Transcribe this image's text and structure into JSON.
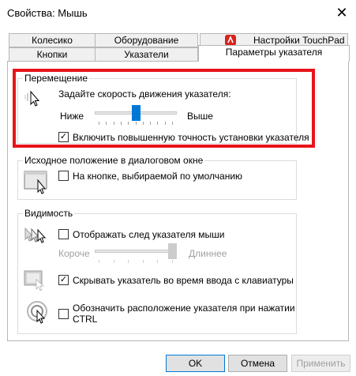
{
  "window": {
    "title": "Свойства: Мышь",
    "close_glyph": "✕"
  },
  "tabs": {
    "row1": [
      "Колесико",
      "Оборудование",
      "Настройки TouchPad"
    ],
    "row2": [
      "Кнопки",
      "Указатели",
      "Параметры указателя"
    ]
  },
  "motion": {
    "title": "Перемещение",
    "speed_label": "Задайте скорость движения указателя:",
    "slow_label": "Ниже",
    "fast_label": "Выше",
    "speed_value": 0.5,
    "precision_label": "Включить повышенную точность установки указателя",
    "precision_checked": true
  },
  "snap": {
    "title": "Исходное положение в диалоговом окне",
    "snap_label": "На кнопке, выбираемой по умолчанию",
    "snap_checked": false
  },
  "visibility": {
    "title": "Видимость",
    "trails_label": "Отображать след указателя мыши",
    "trails_checked": false,
    "short_label": "Короче",
    "long_label": "Длиннее",
    "trails_value": 1.0,
    "hide_label": "Скрывать указатель во время ввода с клавиатуры",
    "hide_checked": true,
    "ctrl_label_line1": "Обозначить расположение указателя при нажатии",
    "ctrl_label_line2": "CTRL",
    "ctrl_checked": false
  },
  "buttons": {
    "ok": "OK",
    "cancel": "Отмена",
    "apply": "Применить"
  },
  "colors": {
    "accent": "#0078d7",
    "highlight": "#e8141b",
    "touchpad_icon": "#d9231c"
  },
  "icons": {
    "motion": "pointer-speed-icon",
    "snap": "snap-to-default-icon",
    "trails": "pointer-trails-icon",
    "hide": "hide-pointer-icon",
    "ctrl": "locate-pointer-icon",
    "touchpad": "touchpad-brand-icon"
  }
}
